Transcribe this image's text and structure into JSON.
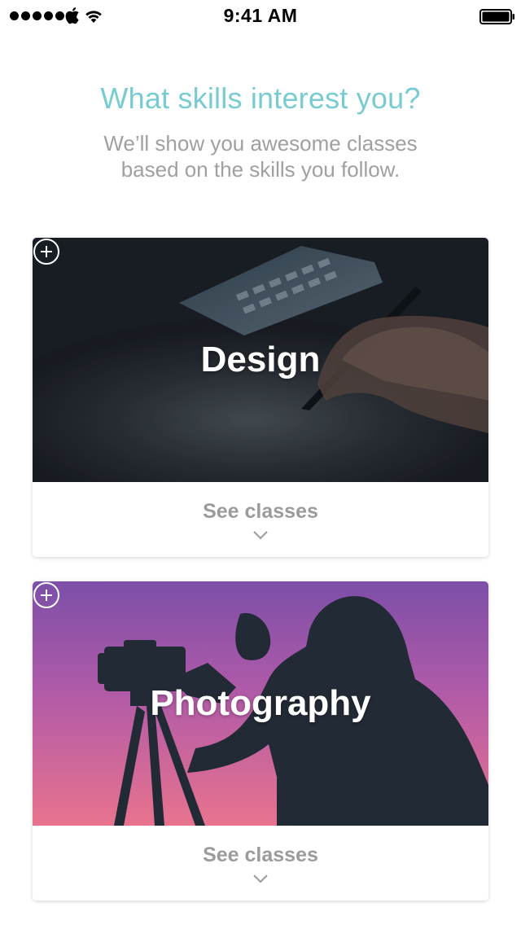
{
  "status_bar": {
    "time": "9:41 AM",
    "signal_icon": "signal-dots-icon",
    "carrier_icon": "apple-icon",
    "wifi_icon": "wifi-icon",
    "battery_icon": "battery-icon"
  },
  "header": {
    "title": "What skills interest you?",
    "subtitle_line1": "We’ll show you awesome classes",
    "subtitle_line2": "based on the skills you follow."
  },
  "skills": [
    {
      "label": "Design",
      "action_label": "See classes",
      "add_icon": "plus-circle-icon",
      "expand_icon": "chevron-down-icon"
    },
    {
      "label": "Photography",
      "action_label": "See classes",
      "add_icon": "plus-circle-icon",
      "expand_icon": "chevron-down-icon"
    }
  ],
  "colors": {
    "title": "#78ccd1",
    "subtitle": "#a0a0a0",
    "see_classes": "#9b9b9b"
  }
}
